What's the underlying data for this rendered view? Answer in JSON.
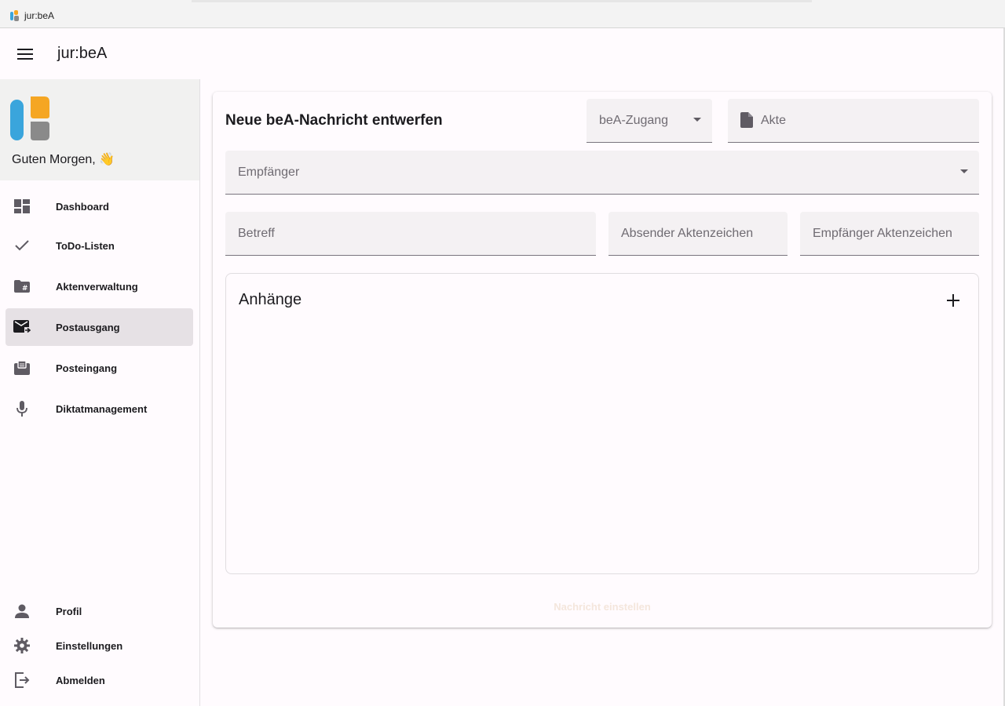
{
  "window": {
    "title": "jur:beA"
  },
  "header": {
    "title": "jur:beA",
    "menu_icon": "hamburger-icon"
  },
  "sidebar": {
    "greeting": "Guten Morgen, 👋",
    "nav": [
      {
        "label": "Dashboard",
        "icon": "dashboard-icon"
      },
      {
        "label": "ToDo-Listen",
        "icon": "check-icon"
      },
      {
        "label": "Aktenverwaltung",
        "icon": "folder-hash-icon"
      },
      {
        "label": "Postausgang",
        "icon": "mail-outgoing-icon",
        "active": true
      },
      {
        "label": "Posteingang",
        "icon": "inbox-icon"
      },
      {
        "label": "Diktatmanagement",
        "icon": "microphone-icon"
      }
    ],
    "bottom": [
      {
        "label": "Profil",
        "icon": "person-icon"
      },
      {
        "label": "Einstellungen",
        "icon": "gear-icon"
      },
      {
        "label": "Abmelden",
        "icon": "logout-icon"
      }
    ]
  },
  "form": {
    "title": "Neue beA-Nachricht entwerfen",
    "bea_zugang": {
      "placeholder": "beA-Zugang"
    },
    "akte": {
      "placeholder": "Akte"
    },
    "empfaenger": {
      "placeholder": "Empfänger"
    },
    "betreff": {
      "placeholder": "Betreff"
    },
    "absender_az": {
      "placeholder": "Absender Aktenzeichen"
    },
    "empfaenger_az": {
      "placeholder": "Empfänger Aktenzeichen"
    },
    "attachments": {
      "title": "Anhänge"
    },
    "submit_label": "Nachricht einstellen"
  },
  "colors": {
    "logo_blue": "#3aa5dc",
    "logo_orange": "#f5a623",
    "logo_gray": "#8a8a8a",
    "active_nav_bg": "#e6e1e5",
    "field_bg": "#f4f1f3"
  }
}
